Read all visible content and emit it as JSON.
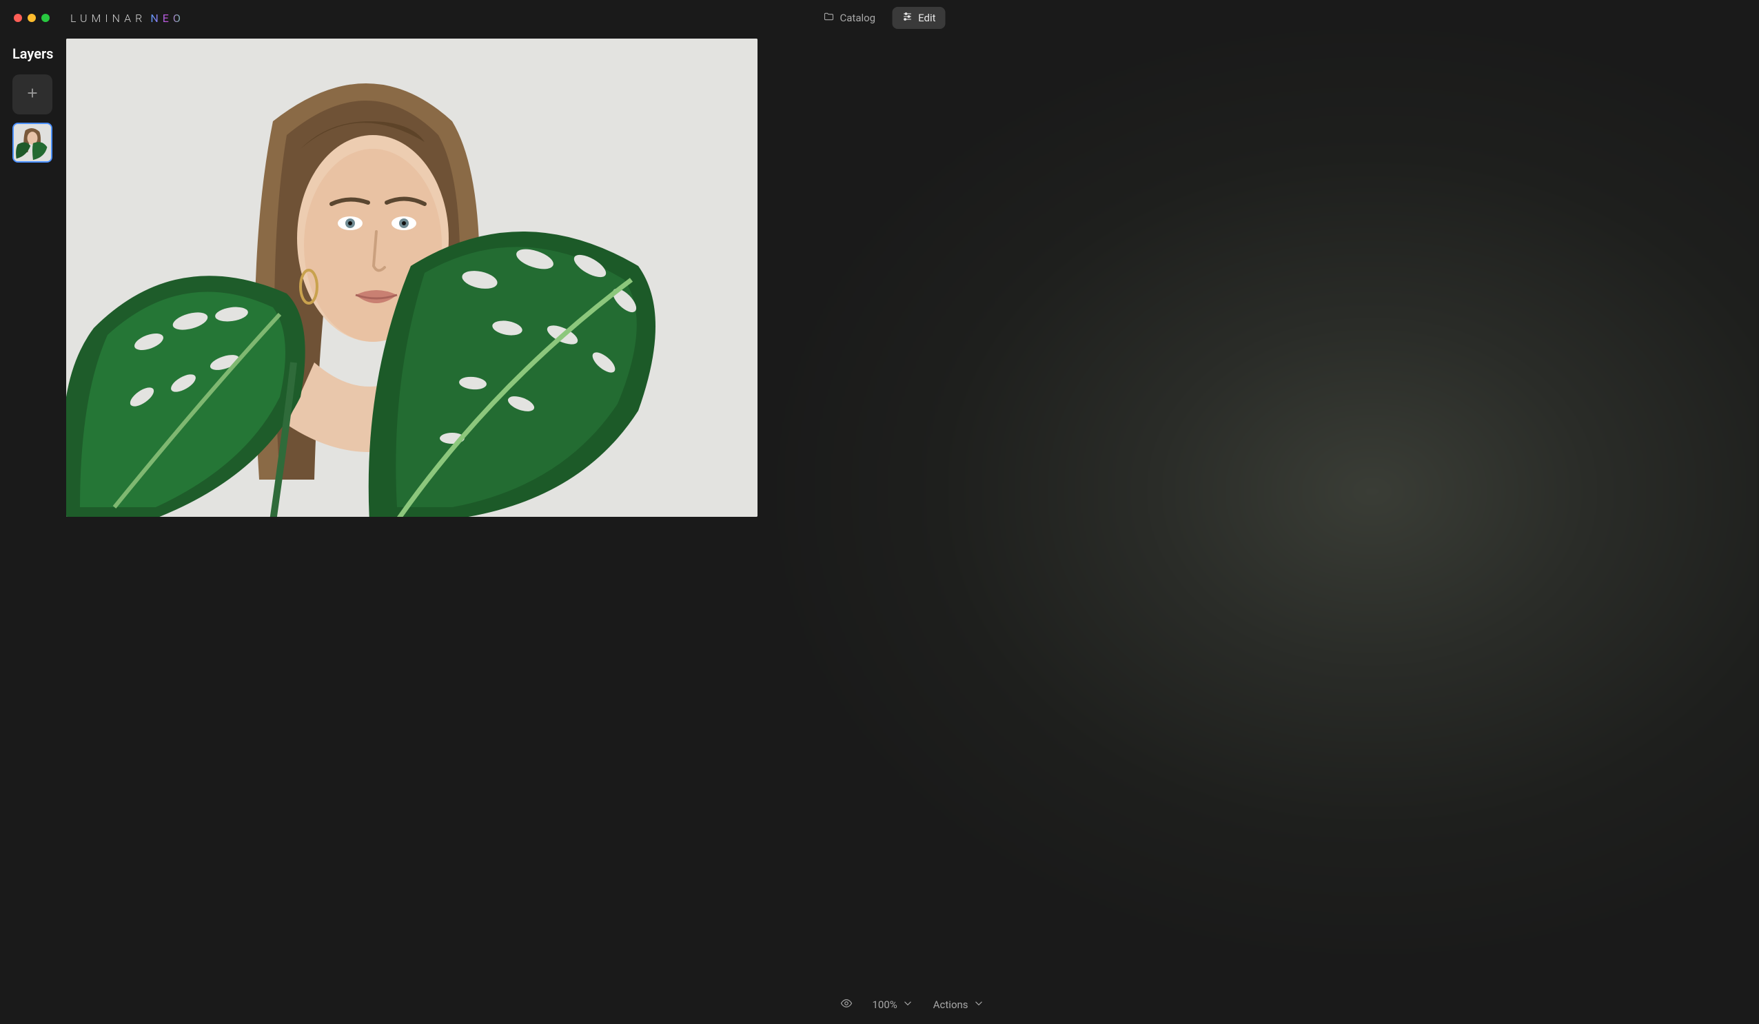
{
  "app": {
    "logo_main": "LUMINAR",
    "logo_suffix": "NEO"
  },
  "tabs": {
    "catalog": "Catalog",
    "edit": "Edit"
  },
  "sidebar": {
    "title": "Layers"
  },
  "bottom": {
    "zoom": "100%",
    "actions": "Actions"
  },
  "icons": {
    "folder": "folder-icon",
    "sliders": "sliders-icon",
    "plus": "plus-icon",
    "eye": "eye-icon",
    "chevron": "chevron-down-icon"
  }
}
